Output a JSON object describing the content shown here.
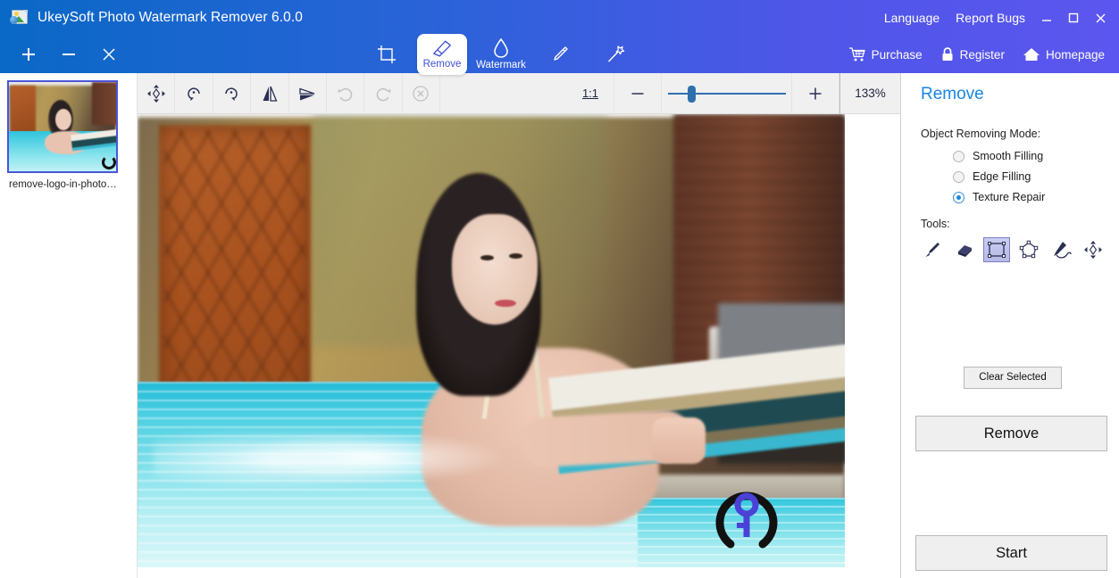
{
  "titlebar": {
    "app_title": "UkeySoft Photo Watermark Remover 6.0.0",
    "app_icon": "photo-app-icon",
    "language_label": "Language",
    "report_bugs_label": "Report Bugs",
    "minimize_icon": "minimize-icon",
    "maximize_icon": "maximize-icon",
    "close_icon": "close-icon",
    "gradient_start": "#0a68c6",
    "gradient_end": "#5b56ef"
  },
  "left_panel_actions": {
    "add_icon": "plus-icon",
    "remove_icon": "minus-icon",
    "clear_icon": "close-icon"
  },
  "toolbar": {
    "items": [
      {
        "label": "",
        "icon": "crop-icon",
        "active": false
      },
      {
        "label": "Remove",
        "icon": "eraser-icon",
        "active": true
      },
      {
        "label": "Watermark",
        "icon": "droplet-icon",
        "active": false
      },
      {
        "label": "",
        "icon": "brush-icon",
        "active": false
      },
      {
        "label": "",
        "icon": "magic-wand-icon",
        "active": false
      }
    ],
    "actions": [
      {
        "label": "Purchase",
        "icon": "cart-icon"
      },
      {
        "label": "Register",
        "icon": "lock-icon"
      },
      {
        "label": "Homepage",
        "icon": "home-icon"
      }
    ]
  },
  "thumbnails": [
    {
      "label": "remove-logo-in-photo…",
      "selected": true
    }
  ],
  "image_toolbar": {
    "buttons": [
      {
        "icon": "move-icon",
        "disabled": false
      },
      {
        "icon": "rotate-left-icon",
        "disabled": false
      },
      {
        "icon": "rotate-right-icon",
        "disabled": false
      },
      {
        "icon": "flip-horizontal-icon",
        "disabled": false
      },
      {
        "icon": "flip-vertical-icon",
        "disabled": false
      },
      {
        "icon": "undo-icon",
        "disabled": true
      },
      {
        "icon": "redo-icon",
        "disabled": true
      },
      {
        "icon": "cancel-icon",
        "disabled": true
      }
    ],
    "fit_ratio_label": "1:1",
    "zoom_out_label": "−",
    "zoom_in_label": "+",
    "zoom_value": "133%",
    "slider_percent": 20
  },
  "canvas": {
    "watermark_icon": "key-in-circle-watermark"
  },
  "right_panel": {
    "title": "Remove",
    "mode_label": "Object Removing Mode:",
    "modes": [
      {
        "label": "Smooth Filling",
        "selected": false
      },
      {
        "label": "Edge Filling",
        "selected": false
      },
      {
        "label": "Texture Repair",
        "selected": true
      }
    ],
    "tools_label": "Tools:",
    "tools": [
      {
        "icon": "brush-icon",
        "selected": false
      },
      {
        "icon": "eraser-icon",
        "selected": false
      },
      {
        "icon": "rectangle-select-icon",
        "selected": true
      },
      {
        "icon": "polygon-select-icon",
        "selected": false
      },
      {
        "icon": "lasso-pen-icon",
        "selected": false
      },
      {
        "icon": "move-icon",
        "selected": false
      }
    ],
    "clear_selected_label": "Clear Selected",
    "remove_label": "Remove",
    "start_label": "Start",
    "accent_color": "#1a86e0"
  }
}
